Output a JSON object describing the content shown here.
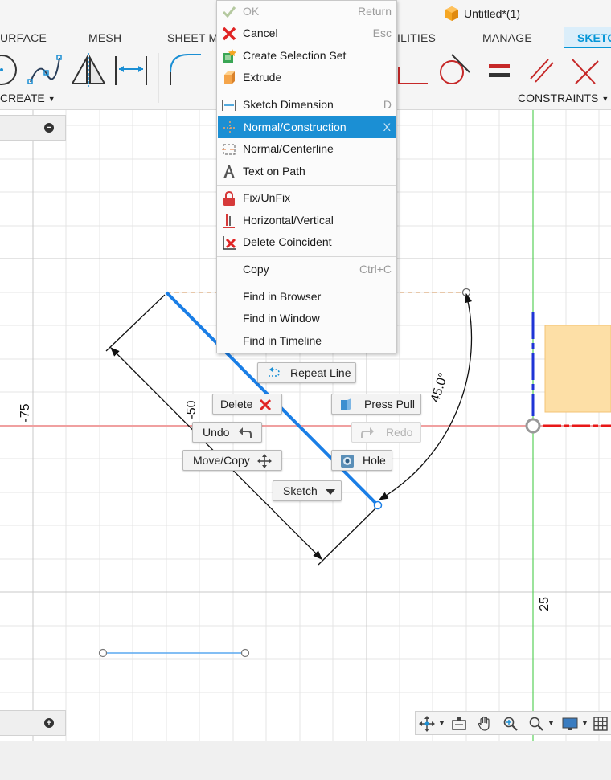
{
  "title": "Untitled*(1)",
  "tabs": [
    {
      "label": "URFACE"
    },
    {
      "label": "MESH"
    },
    {
      "label": "SHEET M"
    },
    {
      "label": "ILITIES"
    },
    {
      "label": "MANAGE"
    },
    {
      "label": "SKETC"
    }
  ],
  "groups": {
    "create": "CREATE",
    "constraints": "CONSTRAINTS"
  },
  "context_menu": {
    "items": [
      {
        "label": "OK",
        "shortcut": "Return",
        "icon": "check-icon",
        "disabled": true
      },
      {
        "label": "Cancel",
        "shortcut": "Esc",
        "icon": "cancel-x-icon"
      },
      {
        "label": "Create Selection Set",
        "shortcut": "",
        "icon": "selection-set-icon"
      },
      {
        "label": "Extrude",
        "shortcut": "",
        "icon": "extrude-icon"
      },
      {
        "label": "Sketch Dimension",
        "shortcut": "D",
        "icon": "sketch-dimension-icon"
      },
      {
        "label": "Normal/Construction",
        "shortcut": "X",
        "icon": "construction-line-icon",
        "selected": true
      },
      {
        "label": "Normal/Centerline",
        "shortcut": "",
        "icon": "centerline-icon"
      },
      {
        "label": "Text on Path",
        "shortcut": "",
        "icon": "text-path-icon"
      },
      {
        "label": "Fix/UnFix",
        "shortcut": "",
        "icon": "lock-icon"
      },
      {
        "label": "Horizontal/Vertical",
        "shortcut": "",
        "icon": "horizontal-vertical-icon"
      },
      {
        "label": "Delete Coincident",
        "shortcut": "",
        "icon": "delete-coincident-icon"
      },
      {
        "label": "Copy",
        "shortcut": "Ctrl+C",
        "icon": ""
      },
      {
        "label": "Find in Browser",
        "shortcut": "",
        "icon": ""
      },
      {
        "label": "Find in Window",
        "shortcut": "",
        "icon": ""
      },
      {
        "label": "Find in Timeline",
        "shortcut": "",
        "icon": ""
      }
    ]
  },
  "marking_menu": {
    "repeat": "Repeat Line",
    "delete": "Delete",
    "press_pull": "Press Pull",
    "undo": "Undo",
    "redo": "Redo",
    "move_copy": "Move/Copy",
    "hole": "Hole",
    "sketch": "Sketch"
  },
  "canvas": {
    "angle_dimension": "45.0°",
    "axis_labels": [
      "-75",
      "-50",
      "25"
    ]
  },
  "colors": {
    "accent": "#0696d7",
    "selected_line": "#1a7ee6",
    "x_axis": "#e02020",
    "y_axis": "#22cc22",
    "menu_highlight": "#1b8fd4",
    "shaded_face": "#fddfa6"
  }
}
